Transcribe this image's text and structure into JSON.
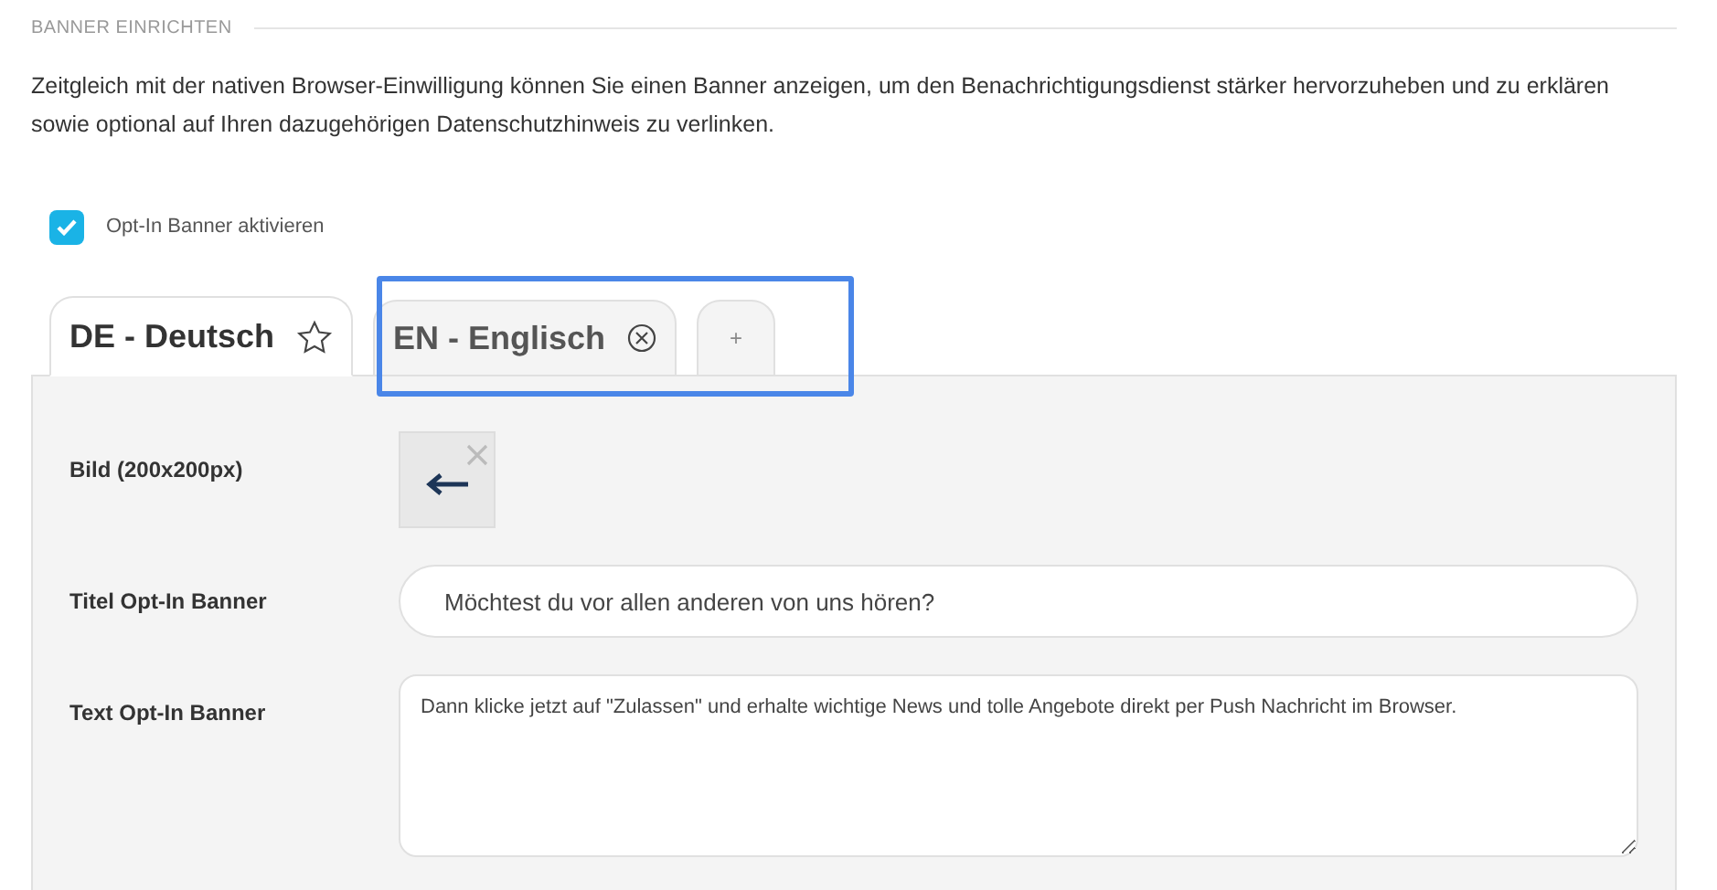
{
  "section_title": "BANNER EINRICHTEN",
  "description": "Zeitgleich mit der nativen Browser-Einwilligung können Sie einen Banner anzeigen, um den Benachrichtigungsdienst stärker hervorzuheben und zu erklären sowie optional auf Ihren dazugehörigen Datenschutzhinweis zu verlinken.",
  "opt_in": {
    "label": "Opt-In Banner aktivieren",
    "checked": true
  },
  "tabs": [
    {
      "label": "DE - Deutsch",
      "kind": "default",
      "selected": true
    },
    {
      "label": "EN - Englisch",
      "kind": "removable",
      "selected": false
    },
    {
      "label": "+",
      "kind": "add",
      "selected": false
    }
  ],
  "form": {
    "image_label": "Bild (200x200px)",
    "title_label": "Titel Opt-In Banner",
    "title_value": "Möchtest du vor allen anderen von uns hören?",
    "text_label": "Text Opt-In Banner",
    "text_value": "Dann klicke jetzt auf \"Zulassen\" und erhalte wichtige News und tolle Angebote direkt per Push Nachricht im Browser."
  }
}
